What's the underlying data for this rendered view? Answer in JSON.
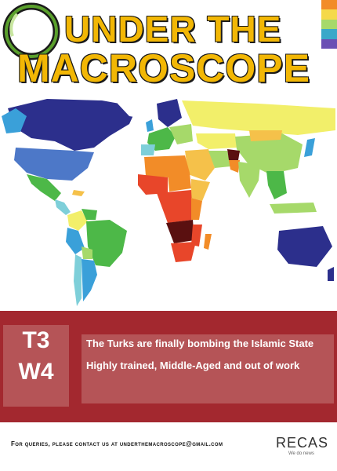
{
  "header": {
    "title_line1": "UNDER THE",
    "title_line2": "MACROSCOPE",
    "stripe_colors": [
      "#f28c28",
      "#f5d94a",
      "#a6d96a",
      "#3aa8c9",
      "#6a4fb4"
    ]
  },
  "map": {
    "legend_colors": [
      "#2c2f8c",
      "#3aa0d9",
      "#7ecfd9",
      "#4db848",
      "#a6d96a",
      "#f2ef6a",
      "#f5c14a",
      "#f28c28",
      "#e8462a",
      "#5a1010"
    ]
  },
  "panel": {
    "code_line1": "T3",
    "code_line2": "W4",
    "headline1": "The Turks are finally bombing the Islamic State",
    "headline2": "Highly trained, Middle-Aged and out of work"
  },
  "footer": {
    "contact": "For queries, please contact us at underthemacroscope@gmail.com",
    "brand": "RECAS",
    "tagline": "We do news"
  }
}
